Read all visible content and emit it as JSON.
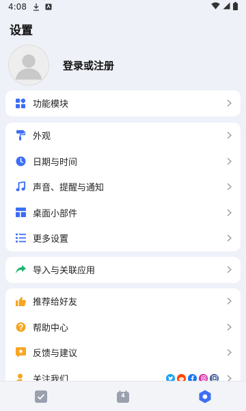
{
  "status_bar": {
    "time": "4:08"
  },
  "page": {
    "title": "设置"
  },
  "profile": {
    "login_label": "登录或注册"
  },
  "groups": [
    {
      "items": [
        {
          "label": "功能模块",
          "icon": "grid-icon"
        }
      ]
    },
    {
      "items": [
        {
          "label": "外观",
          "icon": "paint-roller-icon"
        },
        {
          "label": "日期与时间",
          "icon": "clock-icon"
        },
        {
          "label": "声音、提醒与通知",
          "icon": "music-note-icon"
        },
        {
          "label": "桌面小部件",
          "icon": "widget-icon"
        },
        {
          "label": "更多设置",
          "icon": "list-settings-icon"
        }
      ]
    },
    {
      "items": [
        {
          "label": "导入与关联应用",
          "icon": "share-arrow-icon"
        }
      ]
    },
    {
      "items": [
        {
          "label": "推荐给好友",
          "icon": "thumbs-up-icon"
        },
        {
          "label": "帮助中心",
          "icon": "question-icon"
        },
        {
          "label": "反馈与建议",
          "icon": "feedback-icon"
        },
        {
          "label": "关注我们",
          "icon": "user-follow-icon"
        }
      ]
    }
  ],
  "bottom_nav": {
    "calendar_day": "4",
    "items": [
      "task-check-icon",
      "calendar-icon",
      "settings-hexagon-icon"
    ]
  },
  "colors": {
    "accent": "#3d6ef5",
    "orange": "#f5a623",
    "green": "#22b573"
  }
}
